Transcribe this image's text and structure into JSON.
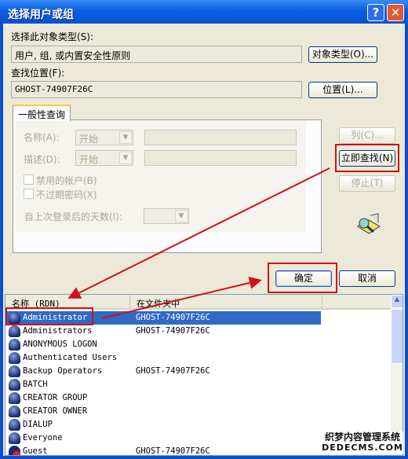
{
  "window": {
    "title": "选择用户或组",
    "help": "?",
    "close": "✕"
  },
  "object_type": {
    "label": "选择此对象类型(S):",
    "value": "用户, 组, 或内置安全性原则",
    "button": "对象类型(O)..."
  },
  "location": {
    "label": "查找位置(F):",
    "value": "GHOST-74907F26C",
    "button": "位置(L)..."
  },
  "tab": {
    "label": "一般性查询"
  },
  "query": {
    "name_label": "名称(A):",
    "name_mode": "开始",
    "name_value": "",
    "desc_label": "描述(D):",
    "desc_mode": "开始",
    "desc_value": "",
    "disabled_accounts": "禁用的帐户(B)",
    "disabled_checked": false,
    "no_expire": "不过期密码(X)",
    "no_expire_checked": false,
    "days_label": "自上次登录后的天数(I):",
    "days_value": ""
  },
  "buttons": {
    "columns": "列(C)...",
    "find_now": "立即查找(N)",
    "stop": "停止(T)",
    "ok": "确定",
    "cancel": "取消"
  },
  "results": {
    "columns": [
      "名称 (RDN)",
      "在文件夹中"
    ],
    "rows": [
      {
        "name": "Administrator",
        "folder": "GHOST-74907F26C",
        "selected": true,
        "icon": "user-icon"
      },
      {
        "name": "Administrators",
        "folder": "GHOST-74907F26C",
        "icon": "group-icon"
      },
      {
        "name": "ANONYMOUS LOGON",
        "folder": "",
        "icon": "group-icon"
      },
      {
        "name": "Authenticated Users",
        "folder": "",
        "icon": "group-icon"
      },
      {
        "name": "Backup Operators",
        "folder": "GHOST-74907F26C",
        "icon": "group-icon"
      },
      {
        "name": "BATCH",
        "folder": "",
        "icon": "group-icon"
      },
      {
        "name": "CREATOR GROUP",
        "folder": "",
        "icon": "group-icon"
      },
      {
        "name": "CREATOR OWNER",
        "folder": "",
        "icon": "group-icon"
      },
      {
        "name": "DIALUP",
        "folder": "",
        "icon": "group-icon"
      },
      {
        "name": "Everyone",
        "folder": "",
        "icon": "group-icon"
      },
      {
        "name": "Guest",
        "folder": "GHOST-74907F26C",
        "icon": "disabled-user-icon"
      }
    ]
  },
  "watermark": {
    "line1": "织梦内容管理系统",
    "line2": "DEDECMS.COM"
  },
  "colors": {
    "annotation": "#d0121a",
    "selection": "#316ac5",
    "titlebar": "#0a5fe0"
  }
}
